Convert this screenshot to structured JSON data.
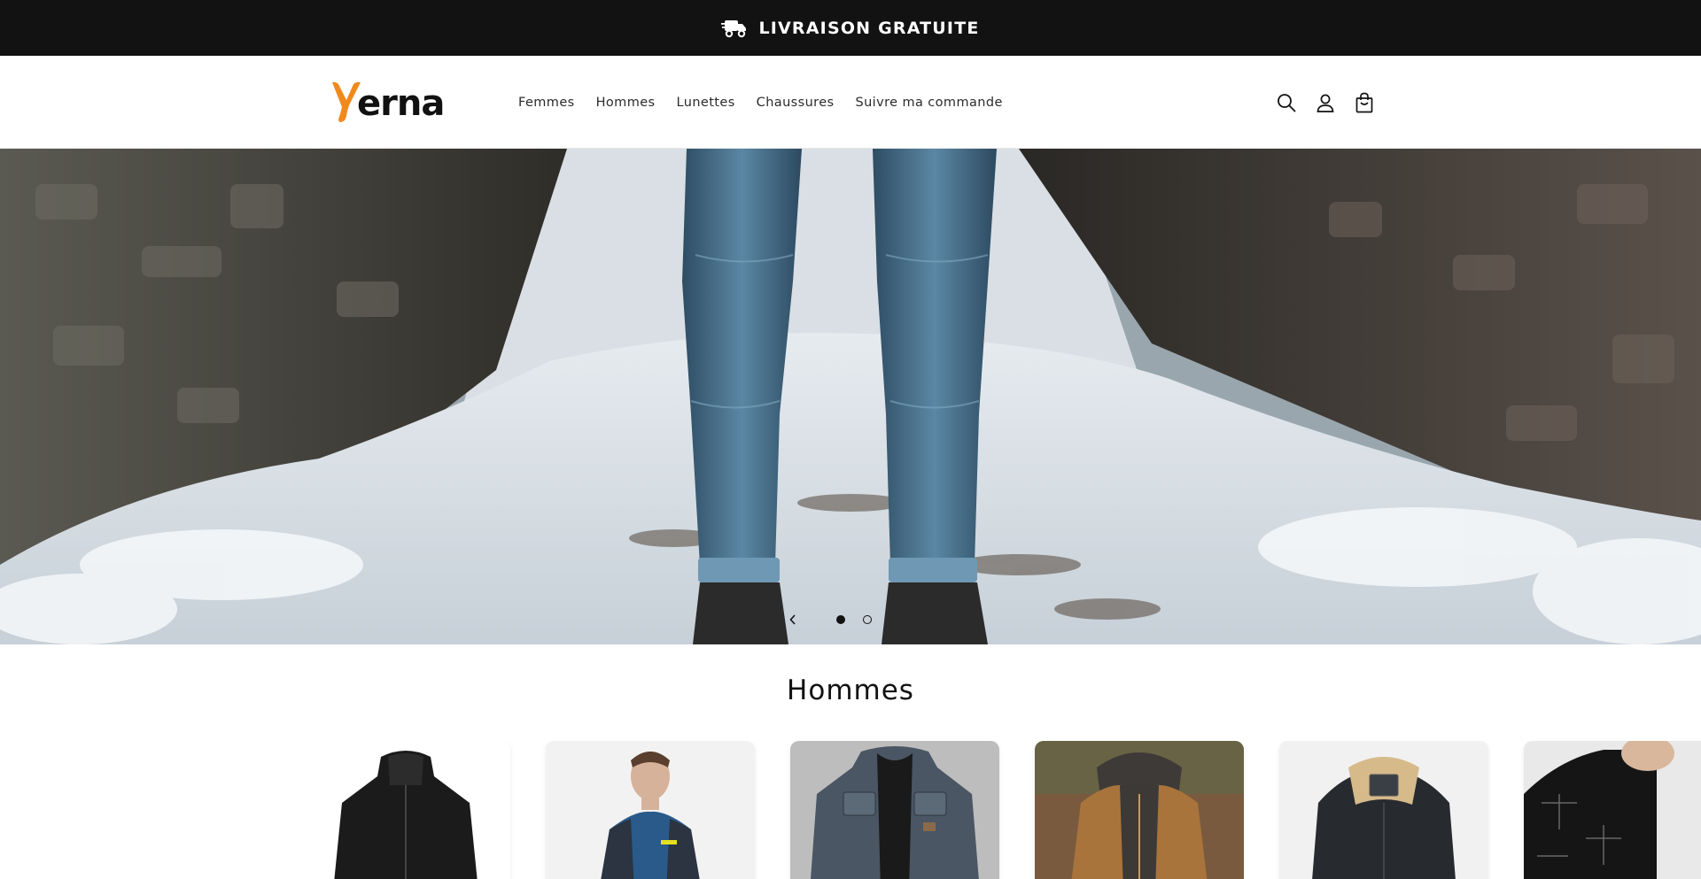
{
  "announcement": {
    "text": "LIVRAISON GRATUITE",
    "icon": "delivery-truck-icon"
  },
  "header": {
    "logo_text": "erna",
    "brand_colors": {
      "accent": "#f08a1c",
      "text": "#111111"
    },
    "nav": [
      {
        "label": "Femmes"
      },
      {
        "label": "Hommes"
      },
      {
        "label": "Lunettes"
      },
      {
        "label": "Chaussures"
      },
      {
        "label": "Suivre ma commande"
      }
    ],
    "icons": [
      "search-icon",
      "account-icon",
      "cart-icon"
    ]
  },
  "hero": {
    "slides": 2,
    "active_slide": 1,
    "prev_icon": "chevron-left-icon"
  },
  "collection": {
    "title": "Hommes",
    "products": [
      {
        "name": "black-wool-coat"
      },
      {
        "name": "blue-hooded-jacket"
      },
      {
        "name": "denim-jacket"
      },
      {
        "name": "brown-hooded-jacket"
      },
      {
        "name": "black-sherpa-jacket"
      },
      {
        "name": "black-patterned-shirt"
      }
    ]
  }
}
